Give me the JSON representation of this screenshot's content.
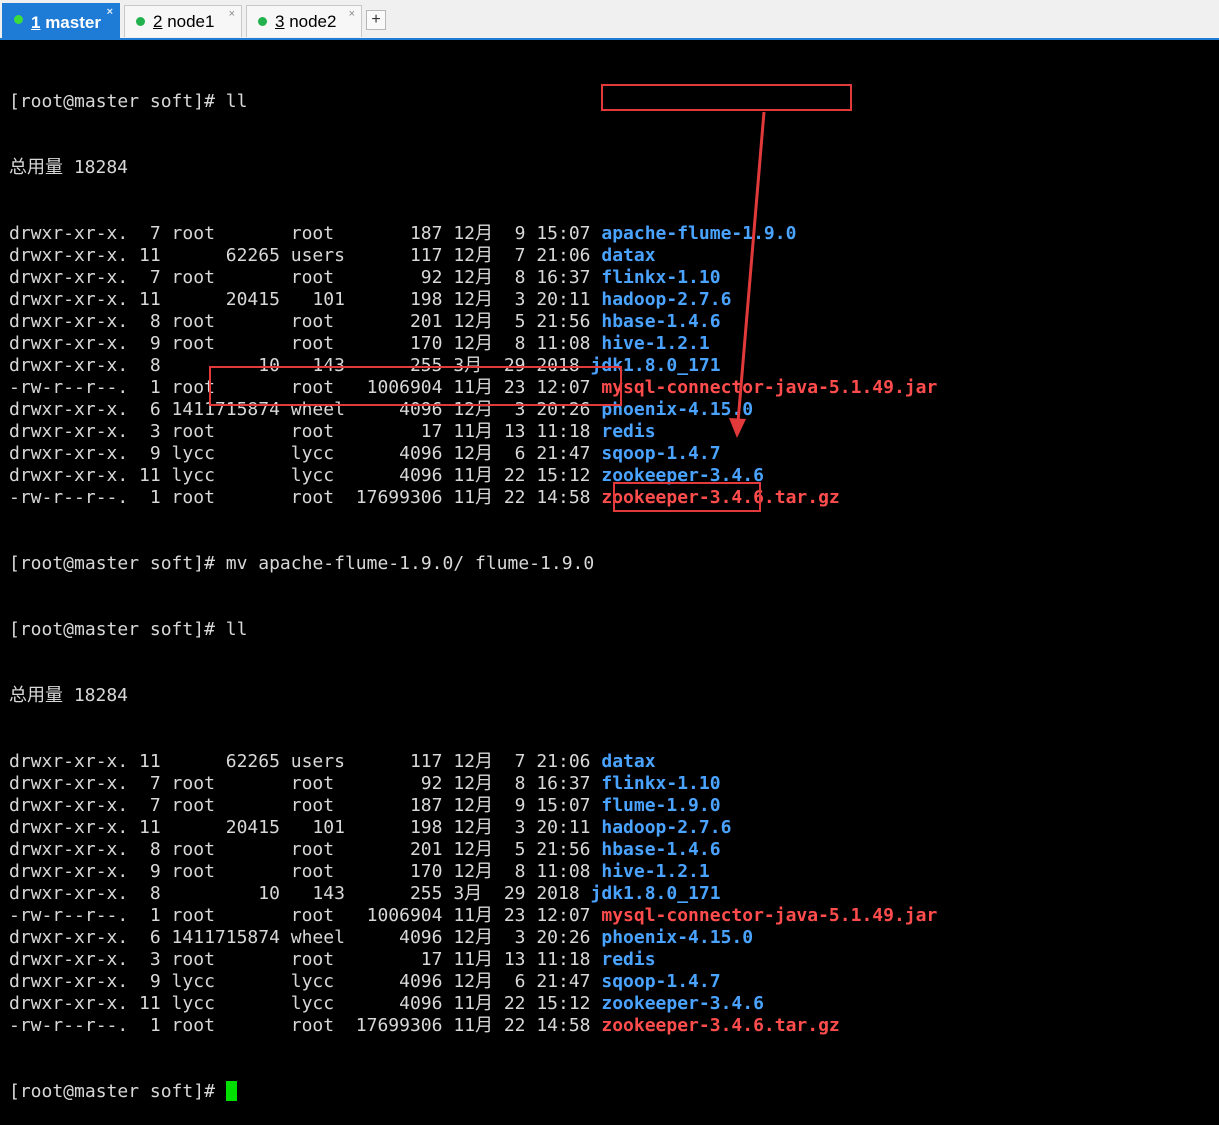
{
  "tabs": [
    {
      "num": "1",
      "name": " master",
      "active": true
    },
    {
      "num": "2",
      "name": " node1",
      "active": false
    },
    {
      "num": "3",
      "name": " node2",
      "active": false
    }
  ],
  "tab_close_glyph": "×",
  "add_tab_glyph": "+",
  "prompt1": "[root@master soft]# ll",
  "total1": "总用量 18284",
  "listing1": [
    {
      "meta": "drwxr-xr-x.  7 root       root       187 12月  9 15:07 ",
      "name": "apache-flume-1.9.0",
      "kind": "dir"
    },
    {
      "meta": "drwxr-xr-x. 11      62265 users      117 12月  7 21:06 ",
      "name": "datax",
      "kind": "dir"
    },
    {
      "meta": "drwxr-xr-x.  7 root       root        92 12月  8 16:37 ",
      "name": "flinkx-1.10",
      "kind": "dir"
    },
    {
      "meta": "drwxr-xr-x. 11      20415   101      198 12月  3 20:11 ",
      "name": "hadoop-2.7.6",
      "kind": "dir"
    },
    {
      "meta": "drwxr-xr-x.  8 root       root       201 12月  5 21:56 ",
      "name": "hbase-1.4.6",
      "kind": "dir"
    },
    {
      "meta": "drwxr-xr-x.  9 root       root       170 12月  8 11:08 ",
      "name": "hive-1.2.1",
      "kind": "dir"
    },
    {
      "meta": "drwxr-xr-x.  8         10   143      255 3月  29 2018 ",
      "name": "jdk1.8.0_171",
      "kind": "dir"
    },
    {
      "meta": "-rw-r--r--.  1 root       root   1006904 11月 23 12:07 ",
      "name": "mysql-connector-java-5.1.49.jar",
      "kind": "arch"
    },
    {
      "meta": "drwxr-xr-x.  6 1411715874 wheel     4096 12月  3 20:26 ",
      "name": "phoenix-4.15.0",
      "kind": "dir"
    },
    {
      "meta": "drwxr-xr-x.  3 root       root        17 11月 13 11:18 ",
      "name": "redis",
      "kind": "dir"
    },
    {
      "meta": "drwxr-xr-x.  9 lycc       lycc      4096 12月  6 21:47 ",
      "name": "sqoop-1.4.7",
      "kind": "dir"
    },
    {
      "meta": "drwxr-xr-x. 11 lycc       lycc      4096 11月 22 15:12 ",
      "name": "zookeeper-3.4.6",
      "kind": "dir"
    },
    {
      "meta": "-rw-r--r--.  1 root       root  17699306 11月 22 14:58 ",
      "name": "zookeeper-3.4.6.tar.gz",
      "kind": "arch"
    }
  ],
  "prompt_prefix": "[root@master soft]# ",
  "mv_command": "mv apache-flume-1.9.0/ flume-1.9.0",
  "prompt3": "[root@master soft]# ll",
  "total2": "总用量 18284",
  "listing2": [
    {
      "meta": "drwxr-xr-x. 11      62265 users      117 12月  7 21:06 ",
      "name": "datax",
      "kind": "dir"
    },
    {
      "meta": "drwxr-xr-x.  7 root       root        92 12月  8 16:37 ",
      "name": "flinkx-1.10",
      "kind": "dir"
    },
    {
      "meta": "drwxr-xr-x.  7 root       root       187 12月  9 15:07 ",
      "name": "flume-1.9.0",
      "kind": "dir"
    },
    {
      "meta": "drwxr-xr-x. 11      20415   101      198 12月  3 20:11 ",
      "name": "hadoop-2.7.6",
      "kind": "dir"
    },
    {
      "meta": "drwxr-xr-x.  8 root       root       201 12月  5 21:56 ",
      "name": "hbase-1.4.6",
      "kind": "dir"
    },
    {
      "meta": "drwxr-xr-x.  9 root       root       170 12月  8 11:08 ",
      "name": "hive-1.2.1",
      "kind": "dir"
    },
    {
      "meta": "drwxr-xr-x.  8         10   143      255 3月  29 2018 ",
      "name": "jdk1.8.0_171",
      "kind": "dir"
    },
    {
      "meta": "-rw-r--r--.  1 root       root   1006904 11月 23 12:07 ",
      "name": "mysql-connector-java-5.1.49.jar",
      "kind": "arch"
    },
    {
      "meta": "drwxr-xr-x.  6 1411715874 wheel     4096 12月  3 20:26 ",
      "name": "phoenix-4.15.0",
      "kind": "dir"
    },
    {
      "meta": "drwxr-xr-x.  3 root       root        17 11月 13 11:18 ",
      "name": "redis",
      "kind": "dir"
    },
    {
      "meta": "drwxr-xr-x.  9 lycc       lycc      4096 12月  6 21:47 ",
      "name": "sqoop-1.4.7",
      "kind": "dir"
    },
    {
      "meta": "drwxr-xr-x. 11 lycc       lycc      4096 11月 22 15:12 ",
      "name": "zookeeper-3.4.6",
      "kind": "dir"
    },
    {
      "meta": "-rw-r--r--.  1 root       root  17699306 11月 22 14:58 ",
      "name": "zookeeper-3.4.6.tar.gz",
      "kind": "arch"
    }
  ],
  "final_prompt": "[root@master soft]# ",
  "colors": {
    "dir": "#4aa3ff",
    "archive": "#ff4d4d",
    "annotation": "#e23a3a",
    "cursor": "#00e000",
    "tab_active": "#1e7bd6"
  }
}
